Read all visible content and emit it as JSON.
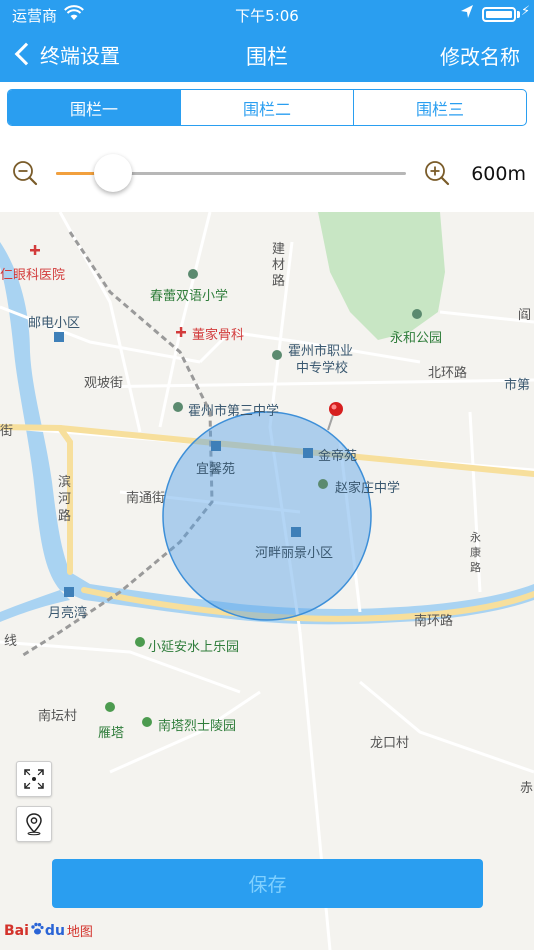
{
  "status_bar": {
    "carrier": "运营商",
    "time": "下午5:06"
  },
  "navbar": {
    "back_label": "终端设置",
    "title": "围栏",
    "right_action": "修改名称"
  },
  "fence_tabs": [
    {
      "label": "围栏一",
      "selected": true
    },
    {
      "label": "围栏二",
      "selected": false
    },
    {
      "label": "围栏三",
      "selected": false
    }
  ],
  "radius": {
    "value_label": "600m",
    "slider_fraction": 0.14
  },
  "map": {
    "labels": {
      "hospital": "仁眼科医院",
      "school_chunlei": "春蕾双语小学",
      "road_jiancai": "建材路",
      "postal": "邮电小区",
      "dongjia": "董家骨科",
      "vocational_1": "霍州市职业",
      "vocational_2": "中专学校",
      "yonghe_park": "永和公园",
      "road_beihuan": "北环路",
      "guanpo": "观坡街",
      "third_middle": "霍州市第三中学",
      "yixin": "宜馨苑",
      "jindi": "金帝苑",
      "zhaojiazhuang": "赵家庄中学",
      "nantong": "南通街",
      "binhe_road": "滨河路",
      "hepan": "河畔丽景小区",
      "yuelianghu": "月亮湾",
      "yongkang": "永康路",
      "nanhuan": "南环路",
      "xiaoyan": "小延安水上乐园",
      "nantan": "南坛村",
      "yanta": "雁塔",
      "nanta_cemetery": "南塔烈士陵园",
      "longkou": "龙口村",
      "jie": "街",
      "xian": "线",
      "shidi": "市第",
      "chi": "赤",
      "yue": "阎"
    }
  },
  "save_label": "保存",
  "logo": {
    "bai": "Bai",
    "du": "du",
    "ditu": "地图"
  }
}
